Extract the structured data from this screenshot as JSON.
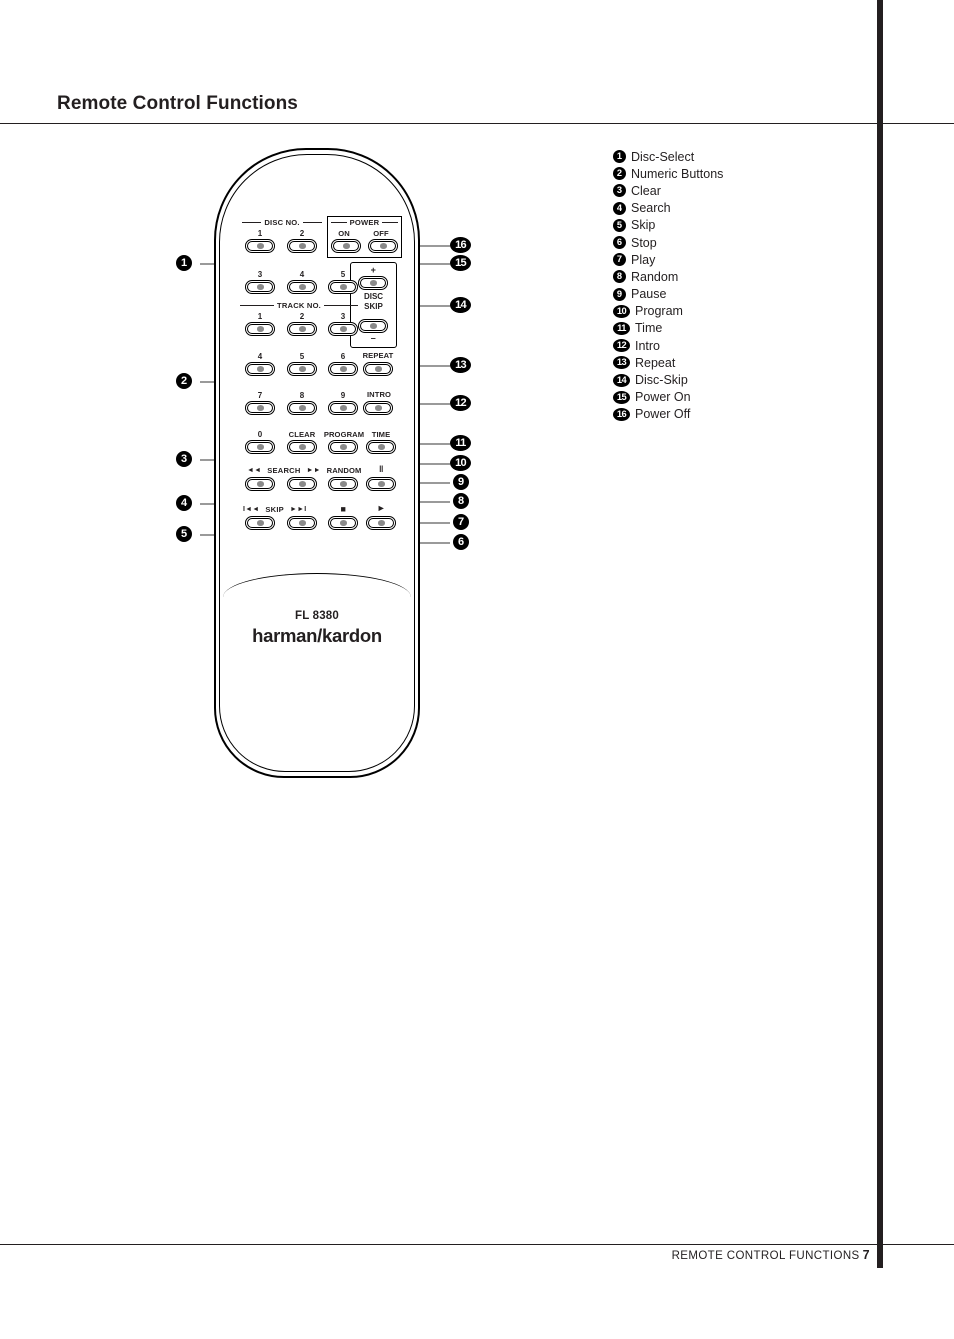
{
  "page": {
    "title": "Remote Control Functions",
    "footer_section": "REMOTE CONTROL FUNCTIONS",
    "footer_page": "7"
  },
  "remote": {
    "model": "FL 8380",
    "brand": "harman/kardon",
    "groups": {
      "disc_no": "DISC NO.",
      "track_no": "TRACK NO.",
      "power": "POWER",
      "disc_skip_line1": "DISC",
      "disc_skip_line2": "SKIP",
      "search": "SEARCH",
      "skip": "SKIP",
      "search_left_icon": "◄◄",
      "search_right_icon": "►►",
      "skip_left_icon": "I◄◄",
      "skip_right_icon": "►►I"
    },
    "buttons": {
      "disc1": "1",
      "disc2": "2",
      "disc3": "3",
      "disc4": "4",
      "disc5": "5",
      "power_on": "ON",
      "power_off": "OFF",
      "skip_plus": "+",
      "skip_minus": "–",
      "track1": "1",
      "track2": "2",
      "track3": "3",
      "num4": "4",
      "num5": "5",
      "num6": "6",
      "num7": "7",
      "num8": "8",
      "num9": "9",
      "num0": "0",
      "repeat": "REPEAT",
      "intro": "INTRO",
      "clear": "CLEAR",
      "program": "PROGRAM",
      "time": "TIME",
      "random": "RANDOM",
      "pause": "‖",
      "stop": "■",
      "play": "►"
    }
  },
  "callouts": {
    "left": [
      "1",
      "2",
      "3",
      "4",
      "5"
    ],
    "right": [
      "16",
      "15",
      "14",
      "13",
      "12",
      "11",
      "10",
      "9",
      "8",
      "7",
      "6"
    ]
  },
  "legend": [
    {
      "num": "1",
      "label": "Disc-Select"
    },
    {
      "num": "2",
      "label": "Numeric Buttons"
    },
    {
      "num": "3",
      "label": "Clear"
    },
    {
      "num": "4",
      "label": "Search"
    },
    {
      "num": "5",
      "label": "Skip"
    },
    {
      "num": "6",
      "label": "Stop"
    },
    {
      "num": "7",
      "label": "Play"
    },
    {
      "num": "8",
      "label": "Random"
    },
    {
      "num": "9",
      "label": "Pause"
    },
    {
      "num": "10",
      "label": "Program"
    },
    {
      "num": "11",
      "label": "Time"
    },
    {
      "num": "12",
      "label": "Intro"
    },
    {
      "num": "13",
      "label": "Repeat"
    },
    {
      "num": "14",
      "label": "Disc-Skip"
    },
    {
      "num": "15",
      "label": "Power On"
    },
    {
      "num": "16",
      "label": "Power Off"
    }
  ],
  "colors": {
    "ink": "#231f20",
    "leader": "#9a9a9a",
    "button_dot": "#8a8a8a"
  }
}
